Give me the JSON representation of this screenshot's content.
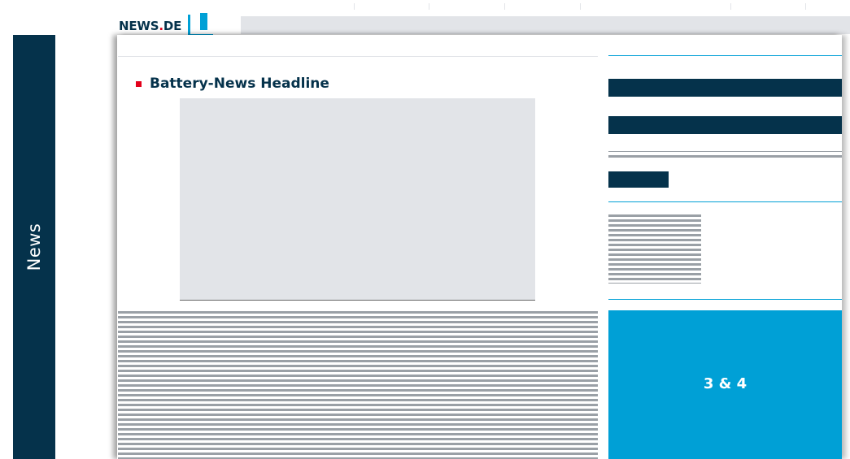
{
  "left_banner": {
    "label": "News",
    "color": "#05324b"
  },
  "logo": {
    "name": "NEWS",
    "dot": ".",
    "tld": "DE",
    "accent_color": "#00a0d6",
    "dot_color": "#e3001b"
  },
  "article": {
    "headline": "Battery-News Headline",
    "bullet_color": "#e3001b"
  },
  "sidebar": {
    "feature_box": {
      "label": "3 & 4",
      "color": "#00a0d6"
    }
  },
  "colors": {
    "navy": "#05324b",
    "placeholder_gray": "#e2e4e8",
    "text_line_gray": "#9aa0a6",
    "rule_blue": "#00a0d6"
  }
}
